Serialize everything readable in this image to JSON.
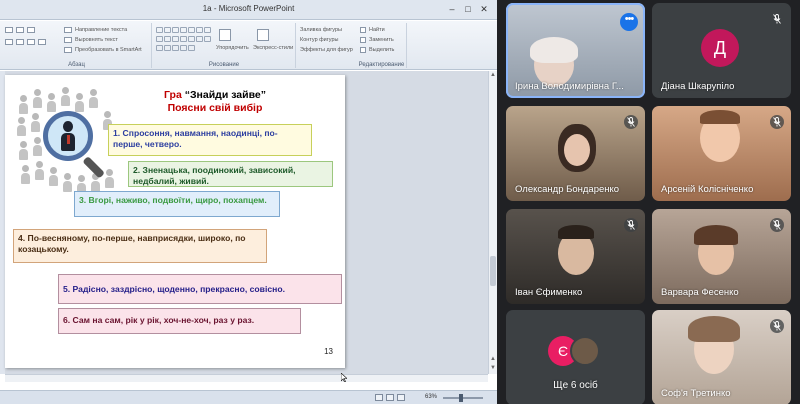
{
  "window": {
    "title": "1a - Microsoft PowerPoint",
    "minimize": "–",
    "maximize": "□",
    "close": "✕"
  },
  "ribbon": {
    "groups": {
      "paragraph": "Абзац",
      "drawing": "Рисование",
      "editing": "Редактирование"
    },
    "items": {
      "text_direction": "Направление текста",
      "align_text": "Выровнять текст",
      "smartart": "Преобразовать в SmartArt",
      "arrange": "Упорядочить",
      "quick_styles": "Экспресс-стили",
      "shape_fill": "Заливка фигуры",
      "shape_outline": "Контур фигуры",
      "shape_effects": "Эффекты для фигур",
      "find": "Найти",
      "replace": "Заменить",
      "select": "Выделить"
    }
  },
  "slide": {
    "title_line1_prefix": "Гра ",
    "title_quote": "“Знайди зайве”",
    "title_line2": "Поясни свій вибір",
    "boxes": [
      "1. Спросоння, навмання, наодинці, по-перше, четверо.",
      "2. Зненацька, поодинокий, зависокий, недбалий, живий.",
      "3. Вгорі, наживо, подвоїти, щиро, похапцем.",
      "4. По-весняному, по-перше, навприсядки, широко, по козацькому.",
      "5. Радісно, заздрісно, щоденно, прекрасно, совісно.",
      "6. Сам на сам, рік у рік, хоч-не-хоч, раз у раз."
    ],
    "number": "13"
  },
  "status": {
    "zoom": "63%"
  },
  "participants": [
    {
      "name": "Ірина Володимирівна Г...",
      "active": true,
      "more_label": "•••"
    },
    {
      "name": "Діана Шкарупіло",
      "initial": "Д",
      "avatar_color": "#c2185b"
    },
    {
      "name": "Олександр Бондаренко"
    },
    {
      "name": "Арсеній Колісніченко"
    },
    {
      "name": "Іван Єфименко"
    },
    {
      "name": "Варвара Фесенко"
    },
    {
      "name": "Ще 6 осіб",
      "initial": "Є",
      "avatar_color": "#e91e63"
    },
    {
      "name": "Соф'я Третинко"
    }
  ]
}
